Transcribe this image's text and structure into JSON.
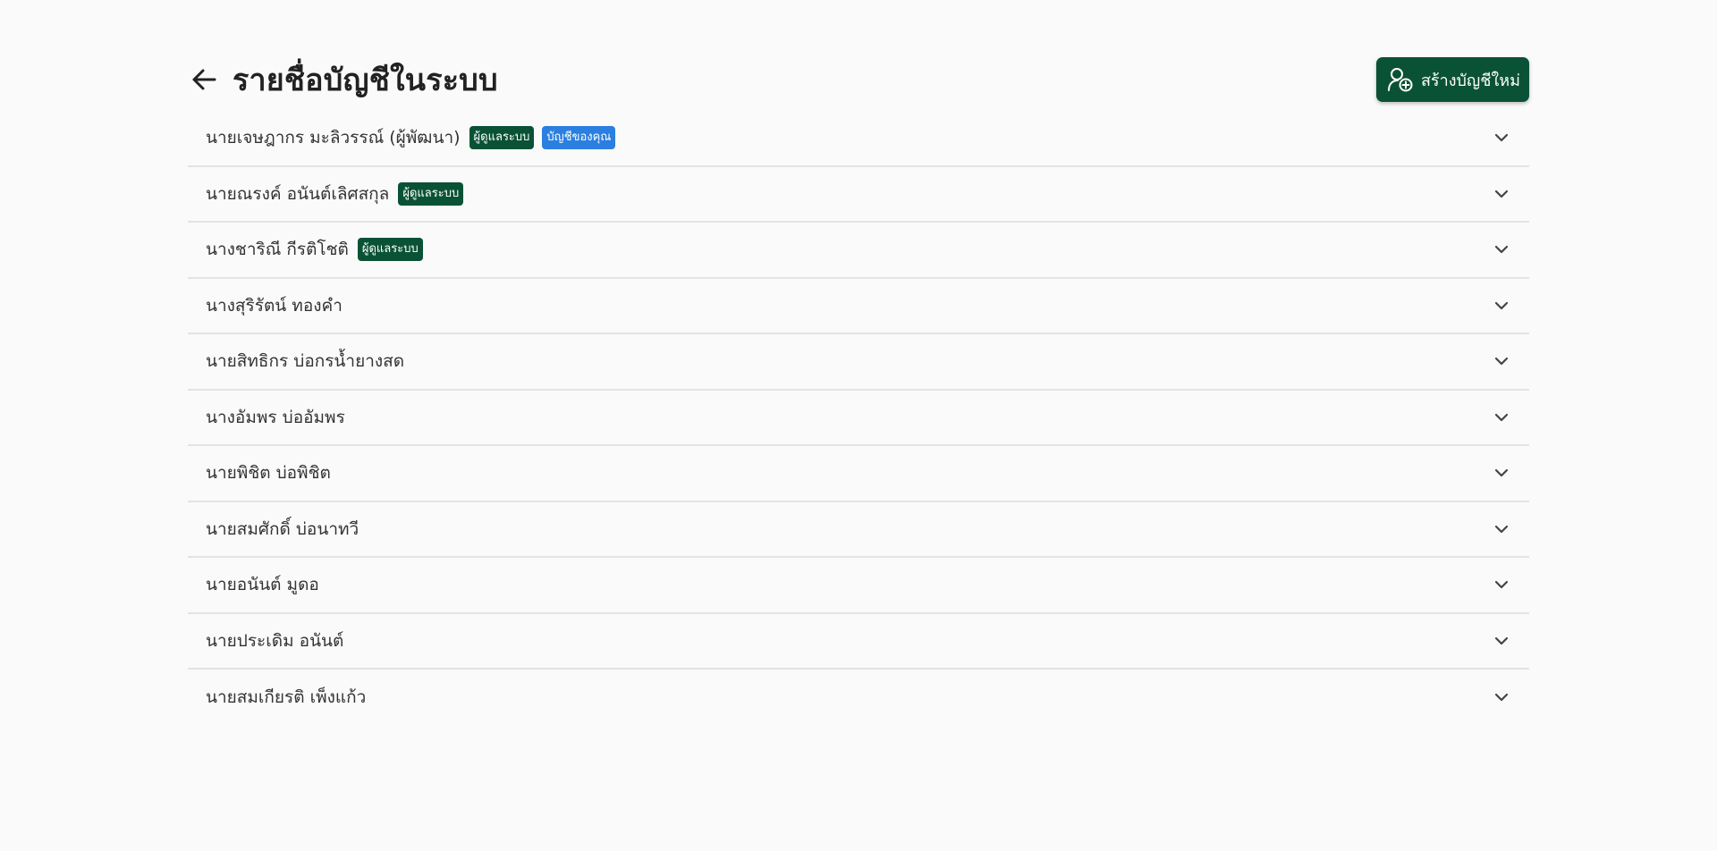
{
  "header": {
    "title": "รายชื่อบัญชีในระบบ",
    "create_label": "สร้างบัญชีใหม่"
  },
  "colors": {
    "primary": "#0a5236",
    "badge_you": "#2a7fe0",
    "background": "#fafafa"
  },
  "icons": {
    "back": "arrow-left-icon",
    "create": "user-add-icon",
    "expand": "chevron-down-icon"
  },
  "accounts": [
    {
      "name": "นายเจษฎากร มะลิวรรณ์ (ผู้พัฒนา)",
      "badges": [
        {
          "label": "ผู้ดูแลระบบ",
          "kind": "admin"
        },
        {
          "label": "บัญชีของคุณ",
          "kind": "you"
        }
      ]
    },
    {
      "name": "นายณรงค์ อนันต์เลิศสกุล",
      "badges": [
        {
          "label": "ผู้ดูแลระบบ",
          "kind": "admin"
        }
      ]
    },
    {
      "name": "นางชาริณี กีรติโชติ",
      "badges": [
        {
          "label": "ผู้ดูแลระบบ",
          "kind": "admin"
        }
      ]
    },
    {
      "name": "นางสุริรัตน์ ทองคำ",
      "badges": []
    },
    {
      "name": "นายสิทธิกร บ่อกรน้ำยางสด",
      "badges": []
    },
    {
      "name": "นางอัมพร บ่ออัมพร",
      "badges": []
    },
    {
      "name": "นายพิชิต บ่อพิชิต",
      "badges": []
    },
    {
      "name": "นายสมศักดิ์ บ่อนาทวี",
      "badges": []
    },
    {
      "name": "นายอนันต์ มูดอ",
      "badges": []
    },
    {
      "name": "นายประเดิม อนันต์",
      "badges": []
    },
    {
      "name": "นายสมเกียรติ เพ็งแก้ว",
      "badges": []
    }
  ]
}
